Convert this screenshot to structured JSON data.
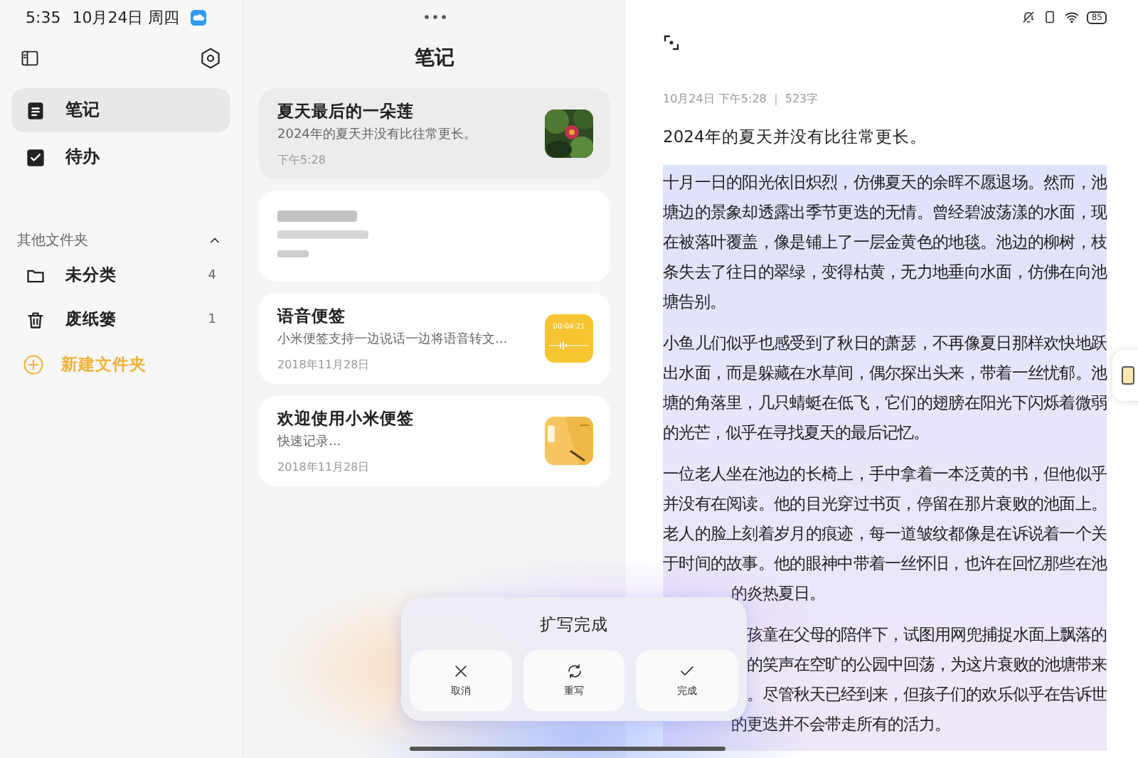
{
  "status_bar": {
    "time": "5:35",
    "date": "10月24日 周四",
    "battery": "85"
  },
  "sidebar": {
    "nav": [
      {
        "label": "笔记",
        "kind": "notes",
        "selected": true
      },
      {
        "label": "待办",
        "kind": "todo",
        "selected": false
      }
    ],
    "folders_header": {
      "label": "其他文件夹",
      "expanded": true
    },
    "folders": [
      {
        "label": "未分类",
        "count": "4",
        "kind": "folder"
      },
      {
        "label": "废纸篓",
        "count": "1",
        "kind": "trash"
      }
    ],
    "new_folder": "新建文件夹"
  },
  "note_list": {
    "title": "笔记",
    "notes": [
      {
        "kind": "picture",
        "title": "夏天最后的一朵莲",
        "preview": "2024年的夏天并没有比往常更长。",
        "time": "下午5:28",
        "selected": true
      },
      {
        "kind": "redacted",
        "selected": false
      },
      {
        "kind": "voice",
        "title": "语音便签",
        "preview": "小米便签支持一边说话一边将语音转文...",
        "time": "2018年11月28日",
        "thumb_text": "00:04:21",
        "selected": false
      },
      {
        "kind": "illustration",
        "title": "欢迎使用小米便签",
        "preview": "快速记录...",
        "time": "2018年11月28日",
        "selected": false
      }
    ]
  },
  "editor": {
    "date": "10月24日 下午5:28",
    "count": "523字",
    "intro": "2024年的夏天并没有比往常更长。",
    "paragraphs": [
      {
        "lines": [
          {
            "kind": "full",
            "text": "十月一日的阳光依旧炽烈，仿佛夏天的余晖不愿退场。然而，池"
          },
          {
            "kind": "full",
            "text": "塘边的景象却透露出季节更迭的无情。曾经碧波荡漾的水面，现"
          },
          {
            "kind": "full",
            "text": "在被落叶覆盖，像是铺上了一层金黄色的地毯。池边的柳树，枝"
          },
          {
            "kind": "full",
            "text": "条失去了往日的翠绿，变得枯黄，无力地垂向水面，仿佛在向池"
          },
          {
            "kind": "last",
            "text": "塘告别。"
          }
        ]
      },
      {
        "lines": [
          {
            "kind": "full",
            "text": "小鱼儿们似乎也感受到了秋日的萧瑟，不再像夏日那样欢快地跃"
          },
          {
            "kind": "full",
            "text": "出水面，而是躲藏在水草间，偶尔探出头来，带着一丝忧郁。池"
          },
          {
            "kind": "full",
            "text": "塘的角落里，几只蜻蜓在低飞，它们的翅膀在阳光下闪烁着微弱"
          },
          {
            "kind": "last",
            "text": "的光芒，似乎在寻找夏天的最后记忆。"
          }
        ]
      },
      {
        "lines": [
          {
            "kind": "full",
            "text": "一位老人坐在池边的长椅上，手中拿着一本泛黄的书，但他似乎"
          },
          {
            "kind": "full",
            "text": "并没有在阅读。他的目光穿过书页，停留在那片衰败的池面上。"
          },
          {
            "kind": "full",
            "text": "老人的脸上刻着岁月的痕迹，每一道皱纹都像是在诉说着一个关"
          },
          {
            "kind": "full",
            "text": "于时间的故事。他的眼神中带着一丝怀旧，也许在回忆那些在池"
          },
          {
            "kind": "partial",
            "text": "的炎热夏日。"
          }
        ]
      },
      {
        "lines": [
          {
            "kind": "covered",
            "text": "孩童在父母的陪伴下，试图用网兜捕捉水面上飘落的"
          },
          {
            "kind": "covered",
            "text": "的笑声在空旷的公园中回荡，为这片衰败的池塘带来"
          },
          {
            "kind": "covered",
            "text": "。尽管秋天已经到来，但孩子们的欢乐似乎在告诉世"
          },
          {
            "kind": "partial",
            "text": "的更迭并不会带走所有的活力。"
          }
        ]
      }
    ]
  },
  "dialog": {
    "title": "扩写完成",
    "buttons": [
      {
        "kind": "cancel",
        "label": "取消"
      },
      {
        "kind": "rewrite",
        "label": "重写"
      },
      {
        "kind": "done",
        "label": "完成"
      }
    ]
  }
}
